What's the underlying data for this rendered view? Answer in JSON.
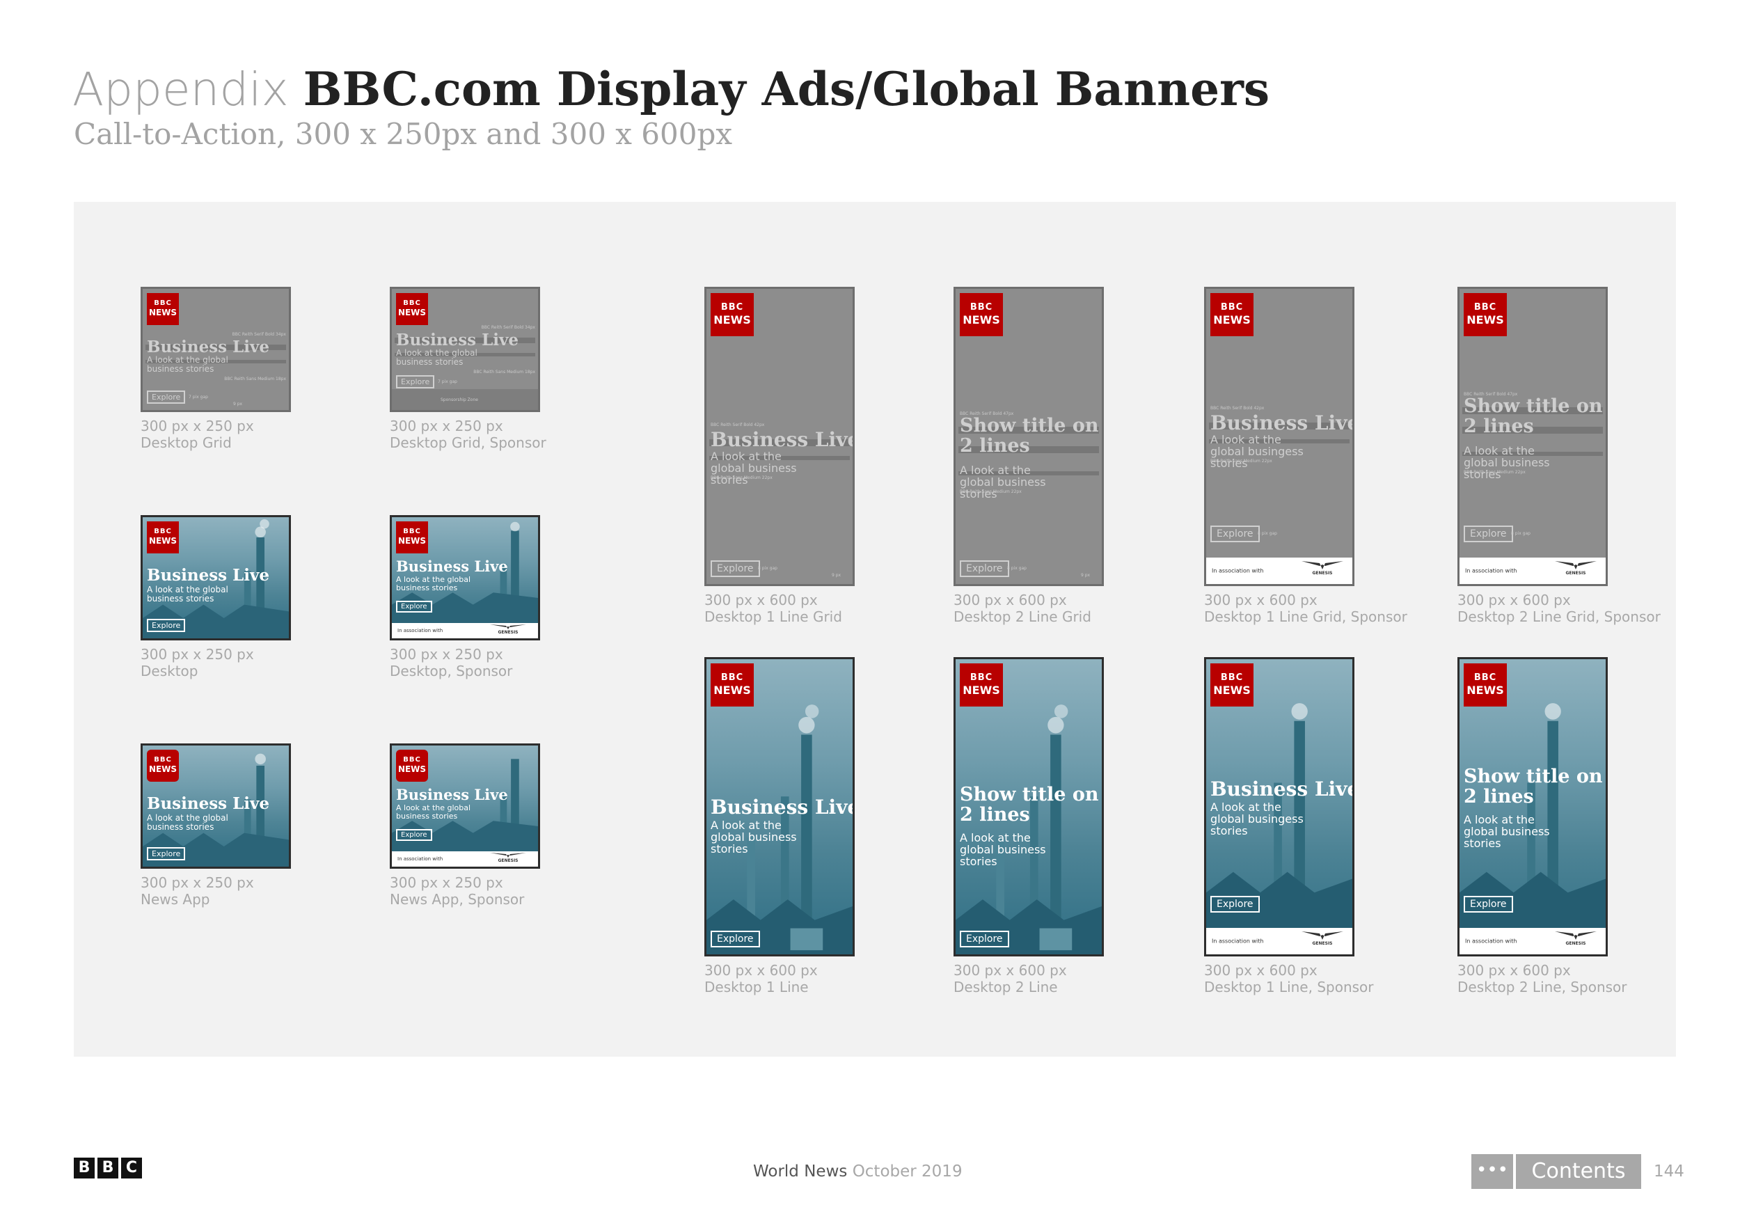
{
  "header": {
    "prefix": "Appendix",
    "title": "BBC.com Display Ads/Global Banners",
    "subtitle": "Call-to-Action, 300 x 250px and 300 x 600px"
  },
  "ad_text": {
    "bbc": "BBC",
    "news": "NEWS",
    "business_live": "Business Live",
    "show_title": "Show title on 2 lines",
    "sub_text": "A look at the global business stories",
    "sub_text_alt": "A look at the global busingess stories",
    "explore": "Explore",
    "in_association": "In association with",
    "sponsor_brand": "GENESIS",
    "guide_title_34": "BBC Reith Serif Bold 34px",
    "guide_sub_18": "BBC Reith Sans Medium 18px",
    "guide_title_42": "BBC Reith Serif Bold 42px",
    "guide_title_47": "BBC Reith Serif Bold 47px",
    "guide_sub_22": "BBC Reith Sans Medium 22px",
    "gap_7": "7 pix gap",
    "gap_8": "8 pix gap",
    "px_9": "9 px",
    "sponsorship_zone": "Sponsorship Zone"
  },
  "captions": {
    "size_250": "300 px x 250 px",
    "size_600": "300 px x 600 px",
    "desktop_grid": "Desktop Grid",
    "desktop_grid_sponsor": "Desktop Grid, Sponsor",
    "desktop": "Desktop",
    "desktop_sponsor": "Desktop, Sponsor",
    "news_app": "News App",
    "news_app_sponsor": "News App, Sponsor",
    "d1_line_grid": "Desktop 1 Line Grid",
    "d2_line_grid": "Desktop 2 Line Grid",
    "d1_line_grid_sponsor": "Desktop 1 Line Grid, Sponsor",
    "d2_line_grid_sponsor": "Desktop 2 Line Grid, Sponsor",
    "d1_line": "Desktop 1 Line",
    "d2_line": "Desktop 2 Line",
    "d1_line_sponsor": "Desktop 1 Line, Sponsor",
    "d2_line_sponsor": "Desktop 2 Line, Sponsor"
  },
  "footer": {
    "logo_letters": [
      "B",
      "B",
      "C"
    ],
    "publication": "World News",
    "date": "October 2019",
    "dots": "•••",
    "contents_label": "Contents",
    "page_number": "144"
  },
  "colors": {
    "bbc_red": "#b80000",
    "grid_grey": "#8d8d8d",
    "teal": "#2e6e84",
    "caption_grey": "#a8a8a8",
    "panel_bg": "#f2f2f2"
  }
}
